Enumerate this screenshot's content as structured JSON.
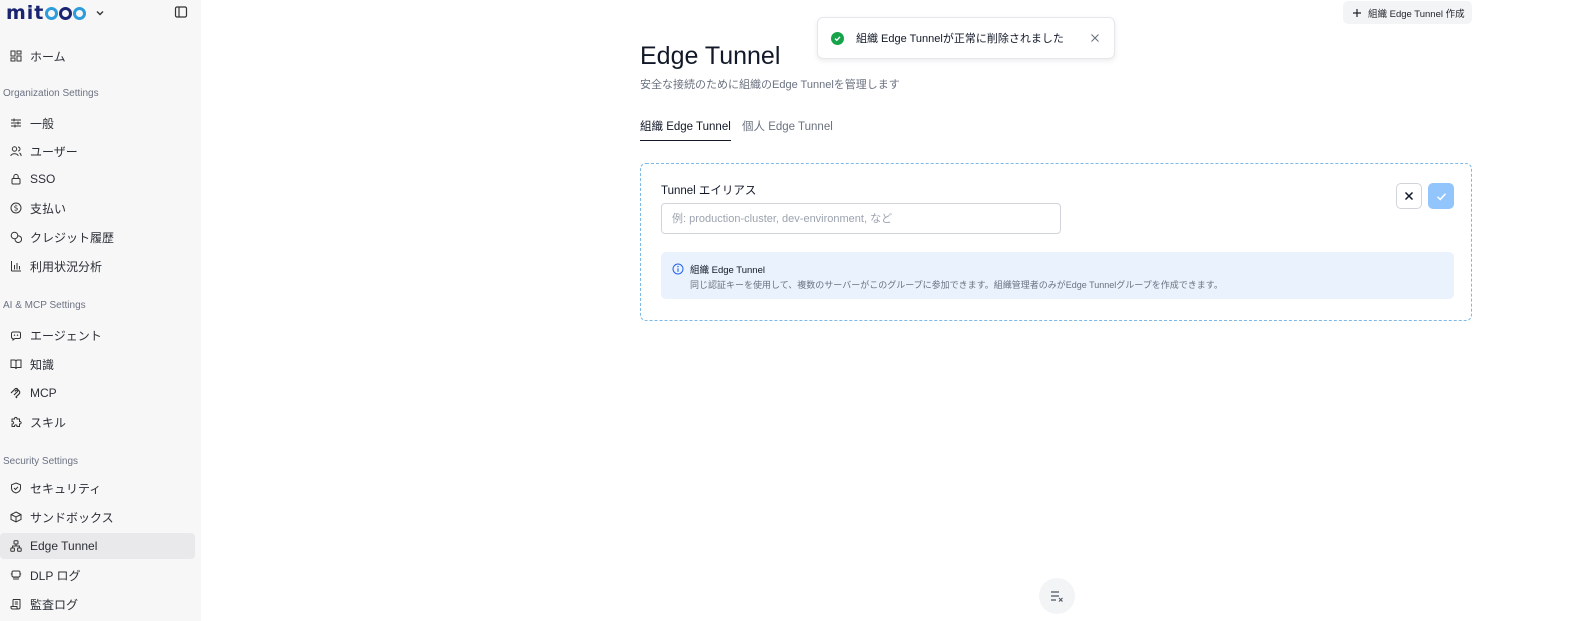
{
  "app": {
    "logo_text": "mit",
    "logo_colors": [
      "#1a2470",
      "#2d9cdb",
      "#1a2470"
    ]
  },
  "sidebar": {
    "home": "ホーム",
    "sections": [
      {
        "title": "Organization Settings"
      },
      {
        "title": "AI & MCP Settings"
      },
      {
        "title": "Security Settings"
      }
    ],
    "items": [
      {
        "label": "一般",
        "icon": "sliders-icon"
      },
      {
        "label": "ユーザー",
        "icon": "users-icon"
      },
      {
        "label": "SSO",
        "icon": "lock-icon"
      },
      {
        "label": "支払い",
        "icon": "dollar-icon"
      },
      {
        "label": "クレジット履歴",
        "icon": "coins-icon"
      },
      {
        "label": "利用状況分析",
        "icon": "bar-chart-icon"
      },
      {
        "label": "エージェント",
        "icon": "bot-icon"
      },
      {
        "label": "知識",
        "icon": "book-icon"
      },
      {
        "label": "MCP",
        "icon": "mcp-icon"
      },
      {
        "label": "スキル",
        "icon": "puzzle-icon"
      },
      {
        "label": "セキュリティ",
        "icon": "shield-icon"
      },
      {
        "label": "サンドボックス",
        "icon": "box-icon"
      },
      {
        "label": "Edge Tunnel",
        "icon": "network-icon"
      },
      {
        "label": "DLP ログ",
        "icon": "dlp-icon"
      },
      {
        "label": "監査ログ",
        "icon": "scroll-icon"
      }
    ],
    "active_item": "Edge Tunnel"
  },
  "toast": {
    "message": "組織 Edge Tunnelが正常に削除されました",
    "status_color": "#16a34a"
  },
  "header": {
    "create_button": "組織 Edge Tunnel 作成",
    "title": "Edge Tunnel",
    "subtitle": "安全な接続のために組織のEdge Tunnelを管理します"
  },
  "tabs": [
    {
      "label": "組織 Edge Tunnel",
      "active": true
    },
    {
      "label": "個人 Edge Tunnel",
      "active": false
    }
  ],
  "form": {
    "label": "Tunnel エイリアス",
    "value": "",
    "placeholder": "例: production-cluster, dev-environment, など",
    "info_title": "組織 Edge Tunnel",
    "info_description": "同じ認証キーを使用して、複数のサーバーがこのグループに参加できます。組織管理者のみがEdge Tunnelグループを作成できます。",
    "accent_color": "#93c5fd"
  }
}
